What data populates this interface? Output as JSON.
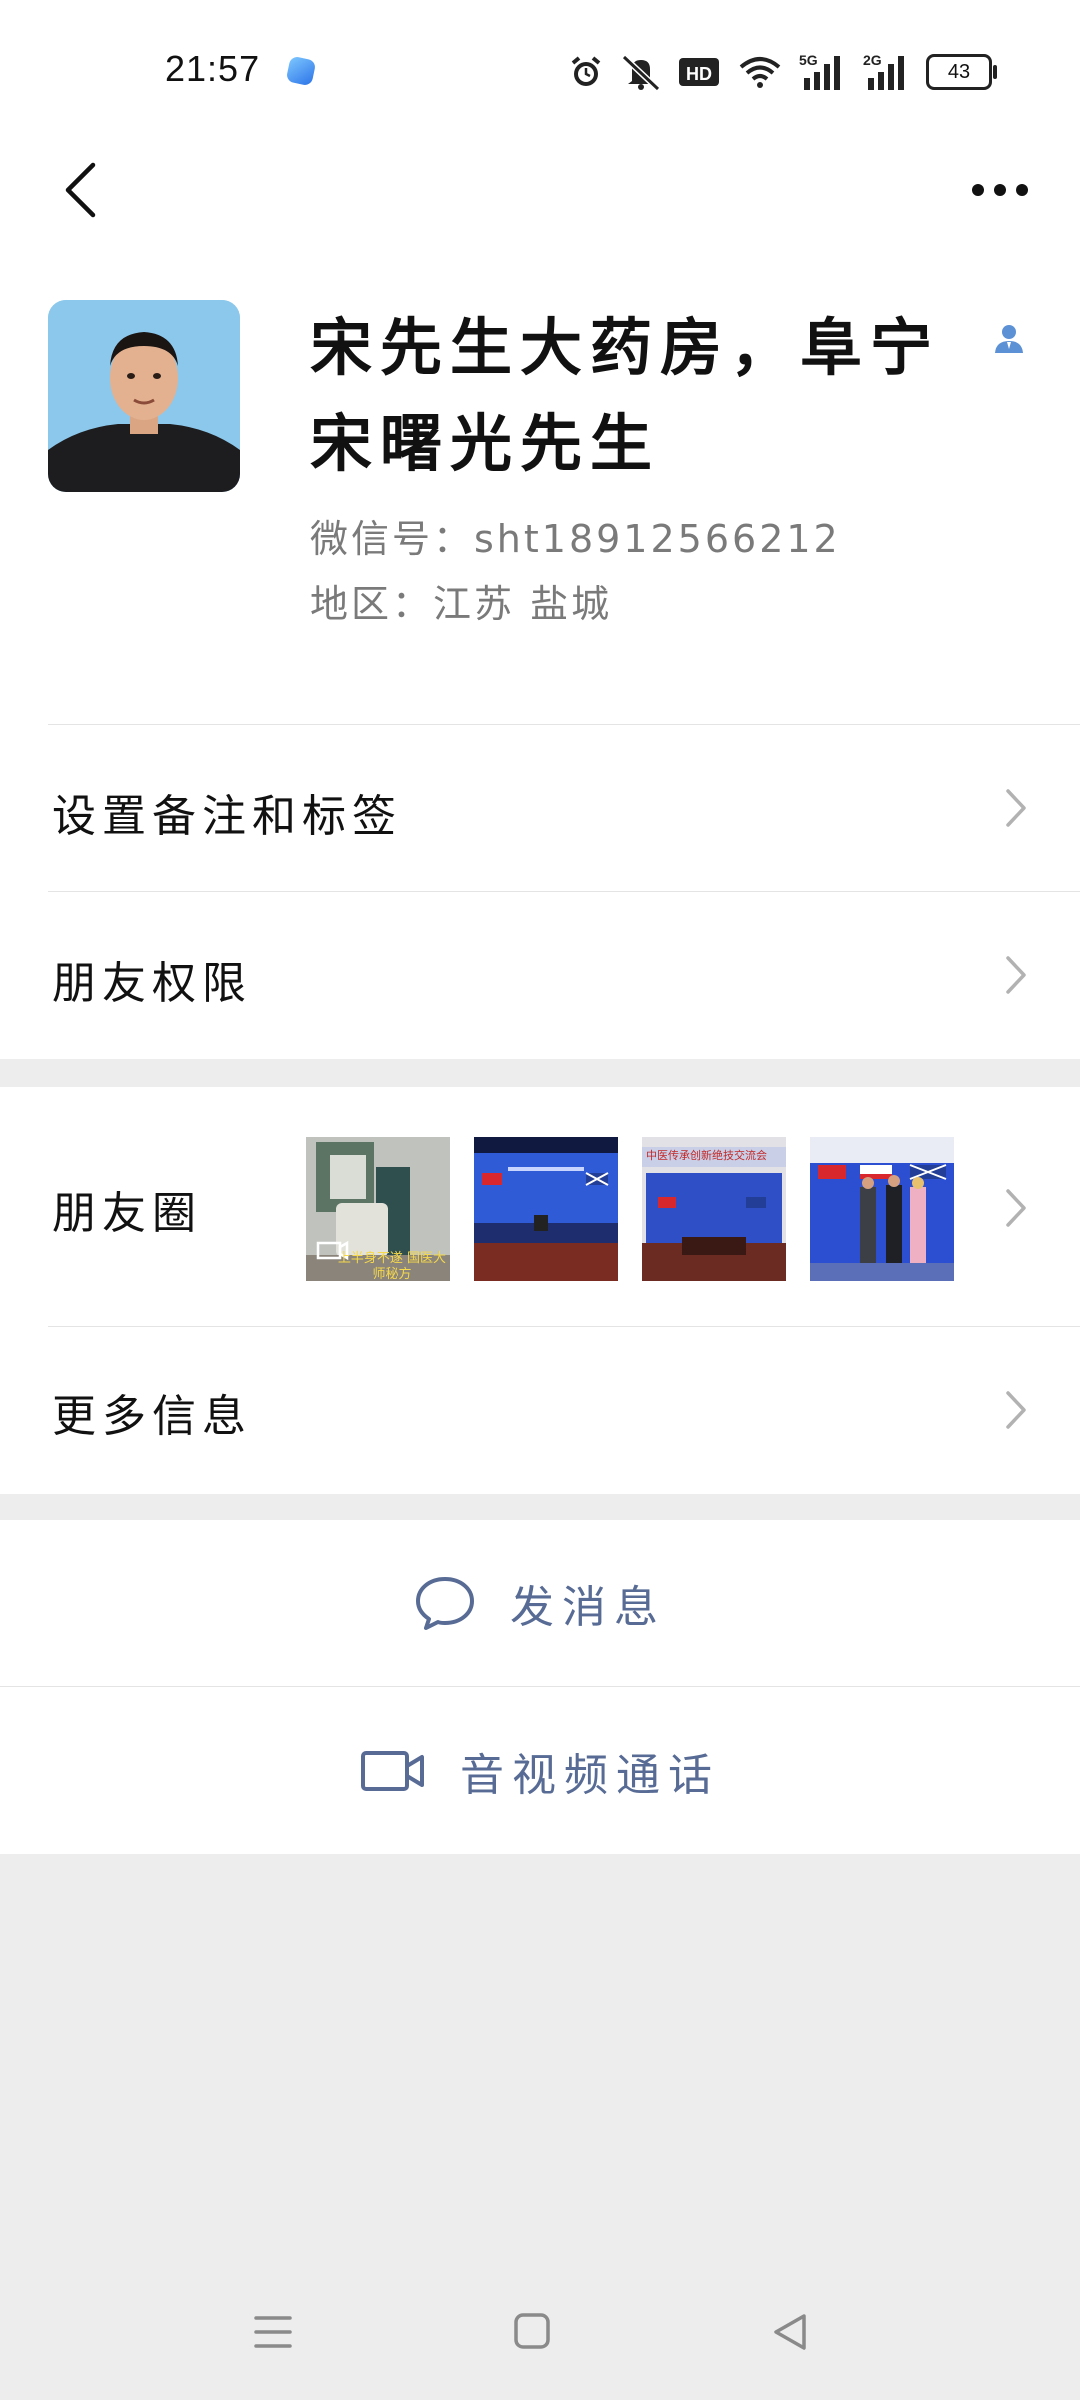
{
  "status_bar": {
    "time": "21:57",
    "network_1": "5G",
    "network_2": "2G",
    "hd_label": "HD",
    "battery": "43"
  },
  "profile": {
    "name": "宋先生大药房，阜宁宋曙光先生",
    "wechat_id": "微信号：sht18912566212",
    "region": "地区：江苏 盐城"
  },
  "menu": {
    "remark_tags": "设置备注和标签",
    "friend_permissions": "朋友权限",
    "moments": "朋友圈",
    "more_info": "更多信息"
  },
  "moments_thumbs": [
    {
      "caption": "上半身不遂 国医大师秘方"
    },
    {
      "caption": ""
    },
    {
      "caption": "中医传承创新绝技交流会"
    },
    {
      "caption": ""
    }
  ],
  "actions": {
    "send_message": "发消息",
    "video_call": "音视频通话"
  },
  "icons": {
    "back": "chevron-left-icon",
    "more": "ellipsis-icon",
    "contact": "contact-person-icon",
    "chevron": "chevron-right-icon",
    "message": "chat-bubble-icon",
    "video": "video-camera-icon",
    "menu": "menu-lines-icon",
    "home": "square-icon",
    "back_triangle": "triangle-back-icon"
  },
  "colors": {
    "link_blue": "#576b95",
    "contact_icon_blue": "#5c91d6",
    "background": "#ededed"
  }
}
